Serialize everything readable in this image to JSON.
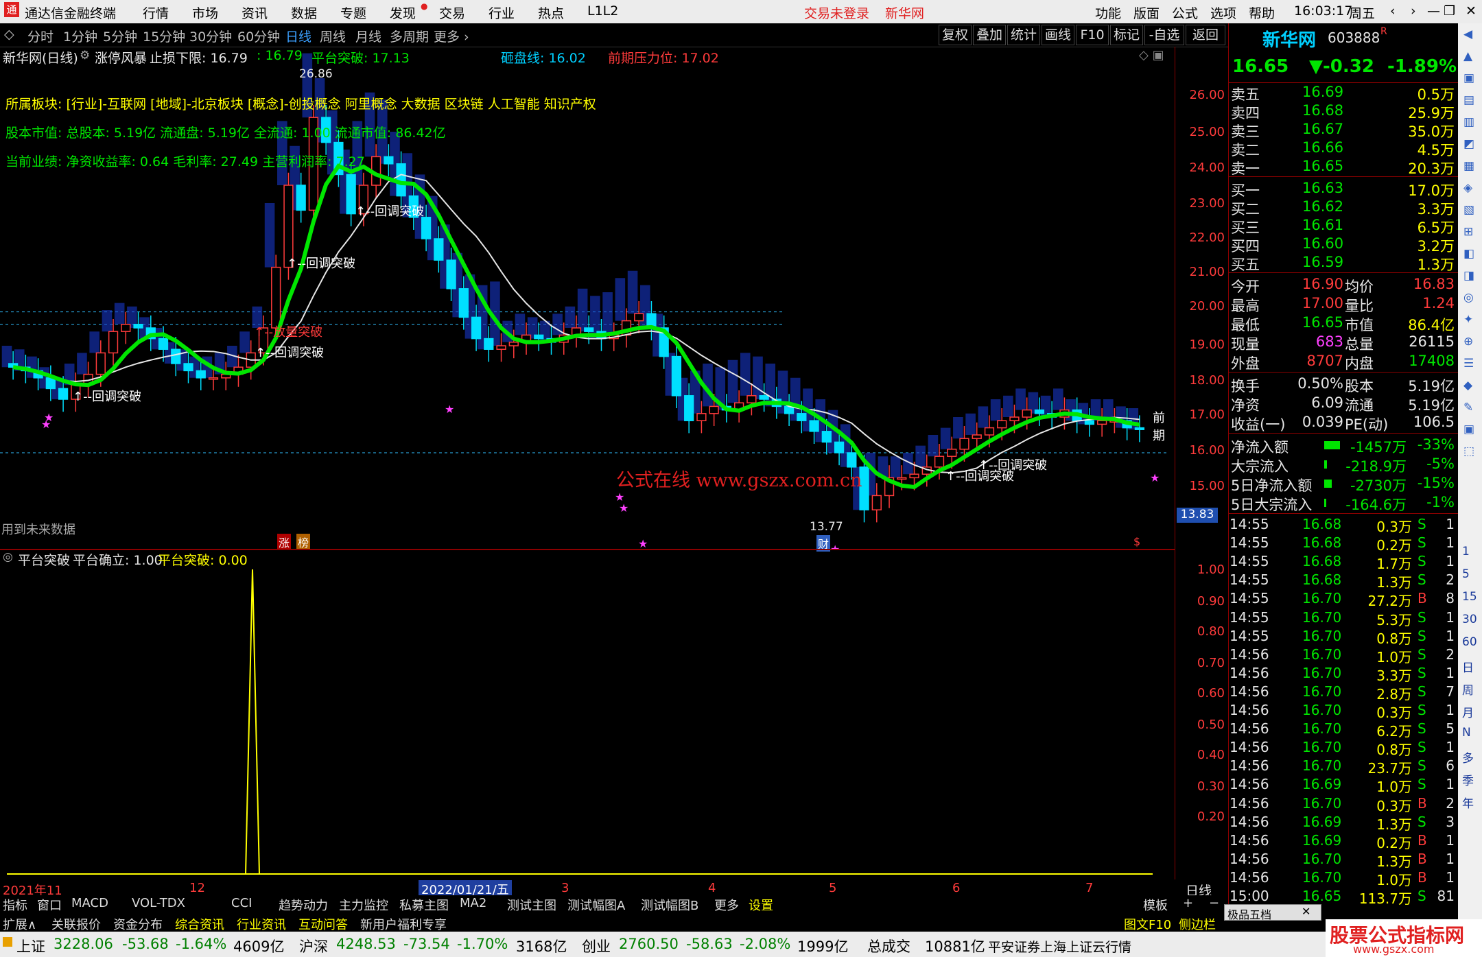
{
  "menubar": {
    "app_title": "通达信金融终端",
    "items": [
      "行情",
      "市场",
      "资讯",
      "数据",
      "专题",
      "发现",
      "交易",
      "行业",
      "热点",
      "L1L2"
    ],
    "trade_status": "交易未登录",
    "stock_name": "新华网",
    "right_items": [
      "功能",
      "版面",
      "公式",
      "选项",
      "帮助"
    ],
    "time": "16:03:17",
    "weekday": "周五",
    "window_controls": [
      "‹",
      "›",
      "—",
      "❐",
      "✕"
    ]
  },
  "toolbar": {
    "periods": [
      "分时",
      "1分钟",
      "5分钟",
      "15分钟",
      "30分钟",
      "60分钟",
      "日线",
      "周线",
      "月线",
      "多周期",
      "更多 ›"
    ],
    "active": "日线",
    "right_buttons": [
      "复权",
      "叠加",
      "统计",
      "画线",
      "F10",
      "标记",
      "-自选",
      "返回"
    ]
  },
  "main_chart": {
    "header": {
      "title": "新华网(日线)",
      "indicator": "涨停风暴",
      "stop_loss_label": "止损下限: 16.79",
      "v1": ": 16.79",
      "platform_break": "平台突破: 17.13",
      "smash_line": "砸盘线: 16.02",
      "pressure": "前期压力位: 17.02"
    },
    "info_lines": [
      "所属板块: [行业]-互联网 [地域]-北京板块 [概念]-创投概念 阿里概念 大数据 区块链 人工智能 知识产权",
      "股本市值: 总股本: 5.19亿 流通盘: 5.19亿 全流通: 1.00 流通市值: 86.42亿",
      "当前业绩: 净资收益率: 0.64 毛利率: 27.49 主营利润率: 7.27"
    ],
    "y_ticks": [
      "26.00",
      "25.00",
      "24.00",
      "23.00",
      "22.00",
      "21.00",
      "20.00",
      "19.00",
      "18.00",
      "17.00",
      "16.00",
      "15.00"
    ],
    "current_price_tag": "13.83",
    "high_label": "26.86",
    "low_label": "13.77",
    "annotations": [
      {
        "text": "↑--回调突破"
      },
      {
        "text": "↑--回调突破"
      },
      {
        "text": "↑--回调突破"
      },
      {
        "text": "↑--放量突破"
      },
      {
        "text": "↑--回调突破"
      },
      {
        "text": "↑--回调突破"
      },
      {
        "text": "↑--回调突破"
      }
    ],
    "watermark": "公式在线  www.gszx.com.cn",
    "future_data": "用到未来数据",
    "right_edge_label": "前期",
    "badge1": "涨",
    "badge2": "榜",
    "badge3": "财",
    "badge4": "$"
  },
  "sub_chart": {
    "header_name": "平台突破",
    "confirm": "平台确立: 1.00",
    "break": "平台突破: 0.00",
    "y_ticks": [
      "1.00",
      "0.90",
      "0.80",
      "0.70",
      "0.60",
      "0.50",
      "0.40",
      "0.30",
      "0.20"
    ]
  },
  "date_axis": {
    "labels": [
      "2021年11",
      "12",
      "2022/01/21/五",
      "3",
      "4",
      "5",
      "6",
      "7"
    ],
    "period": "日线"
  },
  "quote": {
    "name": "新华网",
    "code": "603888",
    "flag": "R",
    "price": "16.65",
    "change": "▼-0.32",
    "pct": "-1.89%",
    "asks": [
      {
        "label": "卖五",
        "price": "16.69",
        "vol": "0.5万"
      },
      {
        "label": "卖四",
        "price": "16.68",
        "vol": "25.9万"
      },
      {
        "label": "卖三",
        "price": "16.67",
        "vol": "35.0万"
      },
      {
        "label": "卖二",
        "price": "16.66",
        "vol": "4.5万"
      },
      {
        "label": "卖一",
        "price": "16.65",
        "vol": "20.3万"
      }
    ],
    "bids": [
      {
        "label": "买一",
        "price": "16.63",
        "vol": "17.0万"
      },
      {
        "label": "买二",
        "price": "16.62",
        "vol": "3.3万"
      },
      {
        "label": "买三",
        "price": "16.61",
        "vol": "6.5万"
      },
      {
        "label": "买四",
        "price": "16.60",
        "vol": "3.2万"
      },
      {
        "label": "买五",
        "price": "16.59",
        "vol": "1.3万"
      }
    ],
    "stats": [
      {
        "l1": "今开",
        "v1": "16.90",
        "l2": "均价",
        "v2": "16.83"
      },
      {
        "l1": "最高",
        "v1": "17.00",
        "l2": "量比",
        "v2": "1.24"
      },
      {
        "l1": "最低",
        "v1": "16.65",
        "l2": "市值",
        "v2": "86.4亿"
      },
      {
        "l1": "现量",
        "v1": "683",
        "l2": "总量",
        "v2": "26115"
      },
      {
        "l1": "外盘",
        "v1": "8707",
        "l2": "内盘",
        "v2": "17408"
      }
    ],
    "fund": [
      {
        "l1": "换手",
        "v1": "0.50%",
        "l2": "股本",
        "v2": "5.19亿"
      },
      {
        "l1": "净资",
        "v1": "6.09",
        "l2": "流通",
        "v2": "5.19亿"
      },
      {
        "l1": "收益(一)",
        "v1": "0.039",
        "l2": "PE(动)",
        "v2": "106.5"
      }
    ],
    "flows": [
      {
        "label": "净流入额",
        "val": "-1457万",
        "pct": "-33%",
        "bar": 0.33
      },
      {
        "label": "大宗流入",
        "val": "-218.9万",
        "pct": "-5%",
        "bar": 0.05
      },
      {
        "label": "5日净流入额",
        "val": "-2730万",
        "pct": "-15%",
        "bar": 0.15
      },
      {
        "label": "5日大宗流入",
        "val": "-164.6万",
        "pct": "-1%",
        "bar": 0.01
      }
    ],
    "ticks": [
      {
        "t": "14:55",
        "p": "16.68",
        "v": "0.3万",
        "d": "S",
        "n": "1"
      },
      {
        "t": "14:55",
        "p": "16.68",
        "v": "0.2万",
        "d": "S",
        "n": "1"
      },
      {
        "t": "14:55",
        "p": "16.68",
        "v": "1.7万",
        "d": "S",
        "n": "1"
      },
      {
        "t": "14:55",
        "p": "16.68",
        "v": "1.3万",
        "d": "S",
        "n": "2"
      },
      {
        "t": "14:55",
        "p": "16.70",
        "v": "27.2万",
        "d": "B",
        "n": "8"
      },
      {
        "t": "14:55",
        "p": "16.70",
        "v": "5.3万",
        "d": "S",
        "n": "1"
      },
      {
        "t": "14:55",
        "p": "16.70",
        "v": "0.8万",
        "d": "S",
        "n": "1"
      },
      {
        "t": "14:56",
        "p": "16.70",
        "v": "1.0万",
        "d": "S",
        "n": "2"
      },
      {
        "t": "14:56",
        "p": "16.70",
        "v": "3.3万",
        "d": "S",
        "n": "1"
      },
      {
        "t": "14:56",
        "p": "16.70",
        "v": "2.8万",
        "d": "S",
        "n": "7"
      },
      {
        "t": "14:56",
        "p": "16.70",
        "v": "0.3万",
        "d": "S",
        "n": "1"
      },
      {
        "t": "14:56",
        "p": "16.70",
        "v": "6.2万",
        "d": "S",
        "n": "5"
      },
      {
        "t": "14:56",
        "p": "16.70",
        "v": "0.8万",
        "d": "S",
        "n": "1"
      },
      {
        "t": "14:56",
        "p": "16.70",
        "v": "23.7万",
        "d": "S",
        "n": "6"
      },
      {
        "t": "14:56",
        "p": "16.69",
        "v": "1.0万",
        "d": "S",
        "n": "1"
      },
      {
        "t": "14:56",
        "p": "16.70",
        "v": "0.3万",
        "d": "B",
        "n": "2"
      },
      {
        "t": "14:56",
        "p": "16.69",
        "v": "1.3万",
        "d": "S",
        "n": "3"
      },
      {
        "t": "14:56",
        "p": "16.69",
        "v": "0.2万",
        "d": "B",
        "n": "1"
      },
      {
        "t": "14:56",
        "p": "16.70",
        "v": "1.3万",
        "d": "B",
        "n": "1"
      },
      {
        "t": "14:56",
        "p": "16.70",
        "v": "1.0万",
        "d": "B",
        "n": "1"
      },
      {
        "t": "15:00",
        "p": "16.65",
        "v": "113.7万",
        "d": "S",
        "n": "81"
      }
    ]
  },
  "right_strip": [
    "1",
    "5",
    "15",
    "30",
    "60",
    "日",
    "周",
    "月",
    "N",
    "多",
    "季",
    "年"
  ],
  "bottom_tabs": [
    "指标",
    "窗口",
    "MACD",
    "VOL-TDX",
    "CCI",
    "趋势动力",
    "主力监控",
    "私募主图",
    "MA2",
    "测试主图",
    "测试幅图A",
    "测试幅图B",
    "更多",
    "设置"
  ],
  "bottom_tabs_right": [
    "模板",
    "+",
    "−"
  ],
  "bottom_tabs2": [
    "扩展∧",
    "关联报价",
    "资金分布",
    "综合资讯",
    "行业资讯",
    "互动问答",
    "新用户福利专享"
  ],
  "bottom_tabs2_right": [
    "图文F10",
    "侧边栏",
    "笔"
  ],
  "pop_label": "极品五档",
  "status": {
    "sh_label": "上证",
    "sh_val": "3228.06",
    "sh_chg": "-53.68",
    "sh_pct": "-1.64%",
    "sh_amt": "4609亿",
    "sz_label": "沪深",
    "sz_val": "4248.53",
    "sz_chg": "-73.54",
    "sz_pct": "-1.70%",
    "sz_amt": "3168亿",
    "cy_label": "创业",
    "cy_val": "2760.50",
    "cy_chg": "-58.63",
    "cy_pct": "-2.08%",
    "cy_amt": "1999亿",
    "total_label": "总成交",
    "total_val": "10881亿",
    "source": "平安证券上海上证云行情",
    "brand": "股票公式指标网",
    "brand_url": "www.gszx.com"
  },
  "chart_data": {
    "type": "candlestick",
    "title": "新华网(日线)",
    "ylim": [
      13.5,
      26.5
    ],
    "closes": [
      18.4,
      18.3,
      18.1,
      17.8,
      17.5,
      17.9,
      18.2,
      18.8,
      19.4,
      19.6,
      19.5,
      19.2,
      18.9,
      18.5,
      18.3,
      18.1,
      18.1,
      18.2,
      18.4,
      18.8,
      19.5,
      21.2,
      23.5,
      22.8,
      25.4,
      24.7,
      23.8,
      22.7,
      23.5,
      24.3,
      24.1,
      23.2,
      22.6,
      22.0,
      21.4,
      20.6,
      19.8,
      19.2,
      18.9,
      19.0,
      19.1,
      19.3,
      19.2,
      19.1,
      19.3,
      19.5,
      19.4,
      19.2,
      19.3,
      19.7,
      19.9,
      19.5,
      18.7,
      17.6,
      16.9,
      17.1,
      17.3,
      17.2,
      17.4,
      17.6,
      17.5,
      17.3,
      17.1,
      16.9,
      16.6,
      16.3,
      16.0,
      15.6,
      14.4,
      14.8,
      15.3,
      15.3,
      15.4,
      15.6,
      15.9,
      16.1,
      16.4,
      16.5,
      16.7,
      16.9,
      17.0,
      17.2,
      17.1,
      17.0,
      17.2,
      16.9,
      16.8,
      16.9,
      16.9,
      16.7,
      16.65
    ]
  }
}
